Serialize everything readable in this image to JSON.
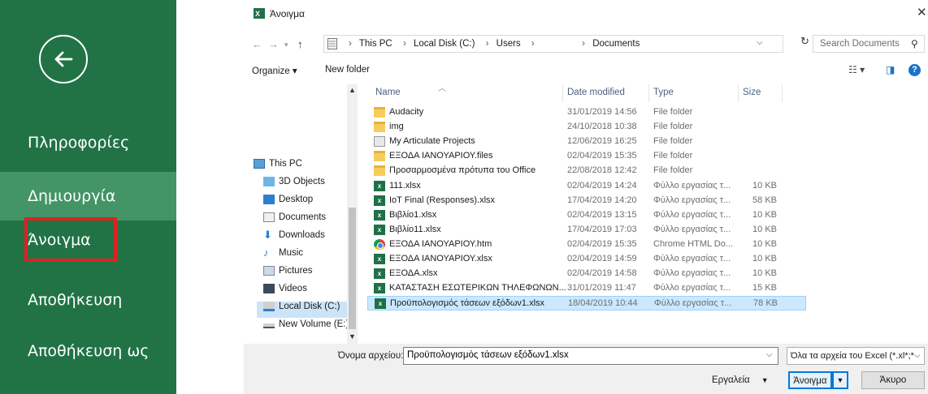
{
  "backstage": {
    "items": [
      {
        "label": "Πληροφορίες"
      },
      {
        "label": "Δημιουργία"
      },
      {
        "label": "Άνοιγμα"
      },
      {
        "label": "Αποθήκευση"
      },
      {
        "label": "Αποθήκευση ως"
      }
    ],
    "highlight_color": "#e02020",
    "bg_color": "#217346"
  },
  "dialog": {
    "title": "Άνοιγμα",
    "breadcrumb": [
      "This PC",
      "Local Disk (C:)",
      "Users",
      "Documents"
    ],
    "search_placeholder": "Search Documents",
    "toolbar": {
      "organize": "Organize ▾",
      "new_folder": "New folder"
    },
    "nav": [
      {
        "label": "This PC",
        "icon": "pc-icon"
      },
      {
        "label": "3D Objects",
        "icon": "cube-icon"
      },
      {
        "label": "Desktop",
        "icon": "desktop-icon"
      },
      {
        "label": "Documents",
        "icon": "documents-icon"
      },
      {
        "label": "Downloads",
        "icon": "download-icon"
      },
      {
        "label": "Music",
        "icon": "music-icon"
      },
      {
        "label": "Pictures",
        "icon": "pictures-icon"
      },
      {
        "label": "Videos",
        "icon": "videos-icon"
      },
      {
        "label": "Local Disk (C:)",
        "icon": "drive-icon"
      },
      {
        "label": "New Volume (E:)",
        "icon": "drive-icon"
      }
    ],
    "columns": [
      "Name",
      "Date modified",
      "Type",
      "Size"
    ],
    "files": [
      {
        "name": "Audacity",
        "date": "31/01/2019 14:56",
        "type": "File folder",
        "size": "",
        "icon": "folder-icon"
      },
      {
        "name": "img",
        "date": "24/10/2018 10:38",
        "type": "File folder",
        "size": "",
        "icon": "folder-icon"
      },
      {
        "name": "My Articulate Projects",
        "date": "12/06/2019 16:25",
        "type": "File folder",
        "size": "",
        "icon": "link-folder-icon"
      },
      {
        "name": "ΕΞΟΔΑ ΙΑΝΟΥΑΡΙΟΥ.files",
        "date": "02/04/2019 15:35",
        "type": "File folder",
        "size": "",
        "icon": "folder-icon"
      },
      {
        "name": "Προσαρμοσμένα πρότυπα του Office",
        "date": "22/08/2018 12:42",
        "type": "File folder",
        "size": "",
        "icon": "folder-icon"
      },
      {
        "name": "111.xlsx",
        "date": "02/04/2019 14:24",
        "type": "Φύλλο εργασίας τ...",
        "size": "10 KB",
        "icon": "excel-file-icon"
      },
      {
        "name": "IoT Final (Responses).xlsx",
        "date": "17/04/2019 14:20",
        "type": "Φύλλο εργασίας τ...",
        "size": "58 KB",
        "icon": "excel-file-icon"
      },
      {
        "name": "Βιβλίο1.xlsx",
        "date": "02/04/2019 13:15",
        "type": "Φύλλο εργασίας τ...",
        "size": "10 KB",
        "icon": "excel-file-icon"
      },
      {
        "name": "Βιβλίο11.xlsx",
        "date": "17/04/2019 17:03",
        "type": "Φύλλο εργασίας τ...",
        "size": "10 KB",
        "icon": "excel-file-icon"
      },
      {
        "name": "ΕΞΟΔΑ ΙΑΝΟΥΑΡΙΟΥ.htm",
        "date": "02/04/2019 15:35",
        "type": "Chrome HTML Do...",
        "size": "10 KB",
        "icon": "chrome-file-icon"
      },
      {
        "name": "ΕΞΟΔΑ ΙΑΝΟΥΑΡΙΟΥ.xlsx",
        "date": "02/04/2019 14:59",
        "type": "Φύλλο εργασίας τ...",
        "size": "10 KB",
        "icon": "excel-file-icon"
      },
      {
        "name": "ΕΞΟΔΑ.xlsx",
        "date": "02/04/2019 14:58",
        "type": "Φύλλο εργασίας τ...",
        "size": "10 KB",
        "icon": "excel-file-icon"
      },
      {
        "name": "ΚΑΤΑΣΤΑΣΗ ΕΣΩΤΕΡΙΚΩΝ ΤΗΛΕΦΩΝΩΝ...",
        "date": "31/01/2019 11:47",
        "type": "Φύλλο εργασίας τ...",
        "size": "15 KB",
        "icon": "excel-file-icon"
      },
      {
        "name": "Προϋπολογισμός τάσεων εξόδων1.xlsx",
        "date": "18/04/2019 10:44",
        "type": "Φύλλο εργασίας τ...",
        "size": "78 KB",
        "icon": "excel-file-icon"
      }
    ],
    "selected_file_index": 13,
    "filename_label": "Όνομα αρχείου:",
    "filename_value": "Προϋπολογισμός τάσεων εξόδων1.xlsx",
    "filter_value": "Όλα τα αρχεία του Excel (*.xl*;*",
    "tools_label": "Εργαλεία",
    "open_label": "Άνοιγμα",
    "cancel_label": "Άκυρο",
    "accent_color": "#0078d7"
  }
}
